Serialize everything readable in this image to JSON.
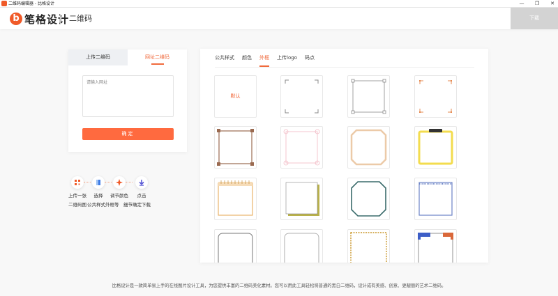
{
  "window": {
    "title": "二维码编辑器 - 比格设计",
    "controls": [
      "—",
      "❐",
      "✕"
    ]
  },
  "header": {
    "brand": "笔格设计",
    "brand_mark": "b",
    "title": "二维码",
    "download": "下载"
  },
  "left": {
    "tabs": [
      {
        "label": "上传二维码",
        "active": false
      },
      {
        "label": "网址二维码",
        "active": true
      }
    ],
    "input_placeholder": "请输入网址",
    "confirm": "确定"
  },
  "steps": {
    "items": [
      {
        "label": "上传一张",
        "icon": "qr-icon"
      },
      {
        "label": "选择",
        "icon": "style-select-icon"
      },
      {
        "label": "调节颜色",
        "icon": "sparkle-icon"
      },
      {
        "label": "点击",
        "icon": "download-arrow-icon"
      }
    ],
    "descriptions": [
      "二维码图",
      "公共样式外框等",
      "细节",
      "确定下载"
    ]
  },
  "right": {
    "tabs": [
      {
        "label": "公共样式",
        "active": false
      },
      {
        "label": "颜色",
        "active": false
      },
      {
        "label": "外框",
        "active": true
      },
      {
        "label": "上传logo",
        "active": false
      },
      {
        "label": "码点",
        "active": false
      }
    ],
    "default_label": "默认",
    "frames": [
      {
        "name": "default",
        "color": "#f05a28"
      },
      {
        "name": "corner-brackets-gray",
        "color": "#8a8a8a"
      },
      {
        "name": "square-handles-gray",
        "color": "#8a8a8a"
      },
      {
        "name": "corner-brackets-orange",
        "color": "#e58a50"
      },
      {
        "name": "ornate-brown",
        "color": "#9a6a50"
      },
      {
        "name": "pink-hearts",
        "color": "#f2b9c4"
      },
      {
        "name": "beveled-beige",
        "color": "#eccaa8"
      },
      {
        "name": "clipboard-yellow",
        "color": "#f3dc4e"
      },
      {
        "name": "notebook-orange",
        "color": "#eab46b"
      },
      {
        "name": "stacked-paper-olive",
        "color": "#b9b14a"
      },
      {
        "name": "octagon-teal",
        "color": "#3a6b6b"
      },
      {
        "name": "stitched-blue",
        "color": "#6b83c6"
      },
      {
        "name": "rounded-gray",
        "color": "#777777"
      },
      {
        "name": "rounded-light-gray",
        "color": "#999999"
      },
      {
        "name": "dashed-gold",
        "color": "#c9962a"
      },
      {
        "name": "color-blocks",
        "color": "#3d5ec7"
      }
    ]
  },
  "footer": "比格设计是一款简单易上手的在线图片设计工具，为您提供丰富的二维码美化素材。您可以用此工具轻松将普通的黑白二维码，设计成有美感、创意、更靓丽的艺术二维码。"
}
